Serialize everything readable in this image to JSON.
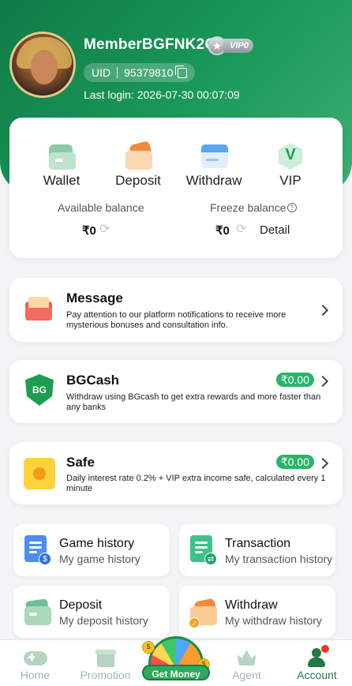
{
  "header": {
    "username": "MemberBGFNK2G",
    "vip_label": "VIP0",
    "uid_label": "UID",
    "uid_value": "95379810",
    "last_login": "Last login: 2026-07-30 00:07:09"
  },
  "wallet": {
    "actions": [
      {
        "label": "Wallet",
        "icon": "wallet-icon"
      },
      {
        "label": "Deposit",
        "icon": "deposit-icon"
      },
      {
        "label": "Withdraw",
        "icon": "withdraw-icon"
      },
      {
        "label": "VIP",
        "icon": "vip-icon"
      }
    ],
    "available_label": "Available balance",
    "available_value": "₹0",
    "freeze_label": "Freeze balance",
    "freeze_value": "₹0",
    "detail_label": "Detail"
  },
  "message": {
    "title": "Message",
    "desc": "Pay attention to our platform notifications to receive more mysterious bonuses and consultation info."
  },
  "bgcash": {
    "title": "BGCash",
    "amount": "₹0.00",
    "desc": "Withdraw using BGcash to get extra rewards and more faster than any banks",
    "icon_text": "BG"
  },
  "safe": {
    "title": "Safe",
    "amount": "₹0.00",
    "desc": "Daily interest rate 0.2% + VIP extra income safe, calculated every 1 minute"
  },
  "grid": [
    {
      "title": "Game history",
      "sub": "My game history"
    },
    {
      "title": "Transaction",
      "sub": "My transaction history"
    },
    {
      "title": "Deposit",
      "sub": "My deposit history"
    },
    {
      "title": "Withdraw",
      "sub": "My withdraw history"
    }
  ],
  "tabbar": {
    "home": "Home",
    "promotion": "Promotion",
    "getmoney": "Get Money",
    "agent": "Agent",
    "account": "Account"
  },
  "colors": {
    "brand_green": "#1b9a5a",
    "active_tab": "#1f7a47",
    "amount_pill": "#2bb36b"
  }
}
